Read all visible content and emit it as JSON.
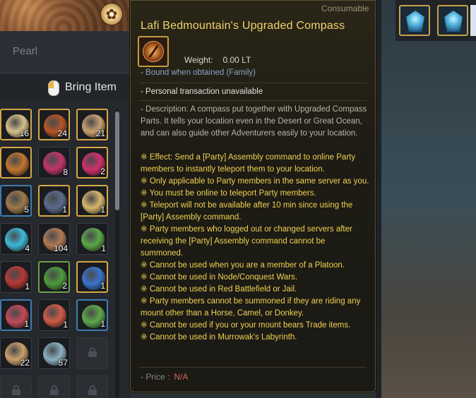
{
  "inventory": {
    "pearl_label": "Pearl",
    "bring_item_label": "Bring Item",
    "slots": [
      {
        "icon": "food-bowl-icon",
        "qty": "16",
        "color": "#d8c08a",
        "frame": "gold"
      },
      {
        "icon": "stew-bowl-icon",
        "qty": "24",
        "color": "#b4552a",
        "frame": "gold"
      },
      {
        "icon": "soup-bowl-icon",
        "qty": "21",
        "color": "#c9a070",
        "frame": "gold"
      },
      {
        "icon": "compass-icon",
        "qty": "",
        "color": "#c2762e",
        "frame": "gold"
      },
      {
        "icon": "pink-potion-icon",
        "qty": "8",
        "color": "#c0356a",
        "frame": "none"
      },
      {
        "icon": "red-potion-icon",
        "qty": "2",
        "color": "#d0306a",
        "frame": "gold"
      },
      {
        "icon": "ore-chunk-icon",
        "qty": "5",
        "color": "#9c7a4a",
        "frame": "blue"
      },
      {
        "icon": "treasure-chest-icon",
        "qty": "1",
        "color": "#5a6a8a",
        "frame": "gold"
      },
      {
        "icon": "scroll-icon",
        "qty": "1",
        "color": "#d6b66a",
        "frame": "gold"
      },
      {
        "icon": "blue-crystal-icon",
        "qty": "4",
        "color": "#3fb8d8",
        "frame": "none"
      },
      {
        "icon": "porridge-bowl-icon",
        "qty": "104",
        "color": "#b07a55",
        "frame": "none"
      },
      {
        "icon": "green-herb-icon",
        "qty": "1",
        "color": "#5aa84a",
        "frame": "none"
      },
      {
        "icon": "red-stone-icon",
        "qty": "1",
        "color": "#b43a34",
        "frame": "none"
      },
      {
        "icon": "green-stone-icon",
        "qty": "2",
        "color": "#4f9a3c",
        "frame": "green"
      },
      {
        "icon": "blue-flame-stone-icon",
        "qty": "1",
        "color": "#3a74c8",
        "frame": "gold"
      },
      {
        "icon": "red-crystal-icon",
        "qty": "1",
        "color": "#c24a58",
        "frame": "blue"
      },
      {
        "icon": "crimson-crystal-icon",
        "qty": "1",
        "color": "#d05a48",
        "frame": "none"
      },
      {
        "icon": "emerald-crystal-icon",
        "qty": "1",
        "color": "#5ea84a",
        "frame": "blue"
      },
      {
        "icon": "wood-log-icon",
        "qty": "22",
        "color": "#caa06a",
        "frame": "none"
      },
      {
        "icon": "tools-icon",
        "qty": "57",
        "color": "#8ab0c0",
        "frame": "none"
      },
      {
        "icon": "lock-icon",
        "qty": "",
        "color": "",
        "frame": "locked"
      },
      {
        "icon": "lock-icon",
        "qty": "",
        "color": "",
        "frame": "locked"
      },
      {
        "icon": "lock-icon",
        "qty": "",
        "color": "",
        "frame": "locked"
      },
      {
        "icon": "lock-icon",
        "qty": "",
        "color": "",
        "frame": "locked"
      }
    ]
  },
  "tooltip": {
    "type": "Consumable",
    "title": "Lafi Bedmountain's Upgraded Compass",
    "weight_label": "Weight:",
    "weight_value": "0.00 LT",
    "bound": "- Bound when obtained (Family)",
    "personal": "- Personal transaction unavailable",
    "description": "- Description: A compass put together with Upgraded Compass Parts. It tells your location even in the Desert or Great Ocean, and can also guide other Adventurers easily to your location.",
    "effects": [
      "※ Effect: Send a [Party] Assembly command to online Party members to instantly teleport them to your location.",
      "※ Only applicable to Party members in the same server as you.",
      "※ You must be online to teleport Party members.",
      "※ Teleport will not be available after 10 min since using the [Party] Assembly command.",
      "※ Party members who logged out or changed servers after receiving the [Party] Assembly command cannot be summoned.",
      "※ Cannot be used when you are a member of a Platoon.",
      "※ Cannot be used in Node/Conquest Wars.",
      "※ Cannot be used in Red Battlefield or Jail.",
      "※ Party members cannot be summoned if they are riding any mount other than a Horse, Camel, or Donkey.",
      "※ Cannot be used if you or your mount bears Trade items.",
      "※  Cannot be used in Murrowak's Labyrinth."
    ],
    "price_label": "- Price :",
    "price_value": "N/A"
  },
  "equip": {
    "slots": [
      {
        "icon": "blue-gem-icon"
      },
      {
        "icon": "blue-gem-icon"
      }
    ]
  },
  "colors": {
    "title": "#f1d36e",
    "effect_text": "#f0d253",
    "frame_gold": "#d7a844",
    "frame_blue": "#3f7db2"
  }
}
